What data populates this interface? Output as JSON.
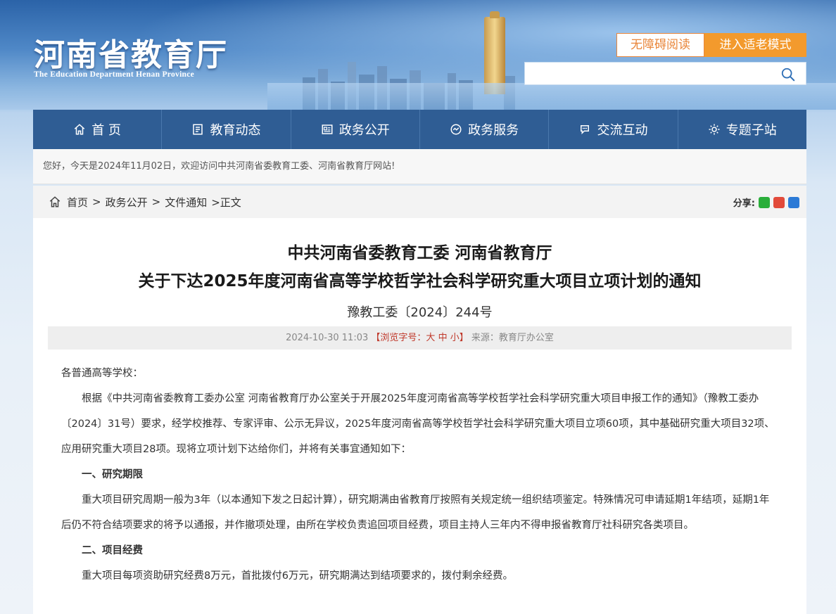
{
  "header": {
    "logo_cn": "河南省教育厅",
    "logo_en": "The Education Department Henan Province",
    "accessibility_label": "无障碍阅读",
    "elder_mode_label": "进入适老模式",
    "search_placeholder": ""
  },
  "nav": {
    "items": [
      {
        "label": "首 页",
        "icon": "home-icon"
      },
      {
        "label": "教育动态",
        "icon": "news-icon"
      },
      {
        "label": "政务公开",
        "icon": "document-icon"
      },
      {
        "label": "政务服务",
        "icon": "service-icon"
      },
      {
        "label": "交流互动",
        "icon": "chat-icon"
      },
      {
        "label": "专题子站",
        "icon": "gear-icon"
      }
    ]
  },
  "greeting": "您好，今天是2024年11月02日，欢迎访问中共河南省委教育工委、河南省教育厅网站!",
  "breadcrumb": {
    "home": "首页",
    "sep": ">",
    "level1": "政务公开",
    "level2": "文件通知",
    "current": ">正文"
  },
  "share": {
    "label": "分享:"
  },
  "article": {
    "title_line1": "中共河南省委教育工委 河南省教育厅",
    "title_line2": "关于下达2025年度河南省高等学校哲学社会科学研究重大项目立项计划的通知",
    "doc_no": "豫教工委〔2024〕244号",
    "datetime": "2024-10-30 11:03",
    "font_size_label": "【浏览字号：",
    "size_large": "大",
    "size_mid": "中",
    "size_small": "小",
    "font_size_end": "】",
    "source": "来源：教育厅办公室",
    "salutation": "各普通高等学校：",
    "para1": "根据《中共河南省委教育工委办公室 河南省教育厅办公室关于开展2025年度河南省高等学校哲学社会科学研究重大项目申报工作的通知》（豫教工委办〔2024〕31号）要求，经学校推荐、专家评审、公示无异议，2025年度河南省高等学校哲学社会科学研究重大项目立项60项，其中基础研究重大项目32项、应用研究重大项目28项。现将立项计划下达给你们，并将有关事宜通知如下：",
    "section1_title": "一、研究期限",
    "para2": "重大项目研究周期一般为3年（以本通知下发之日起计算），研究期满由省教育厅按照有关规定统一组织结项鉴定。特殊情况可申请延期1年结项，延期1年后仍不符合结项要求的将予以通报，并作撤项处理，由所在学校负责追回项目经费，项目主持人三年内不得申报省教育厅社科研究各类项目。",
    "section2_title": "二、项目经费",
    "para3": "重大项目每项资助研究经费8万元，首批拨付6万元，研究期满达到结项要求的，拨付剩余经费。"
  },
  "colors": {
    "nav_bg": "#2f5d94",
    "accent_orange": "#f39a2d",
    "size_red": "#c0392b"
  }
}
